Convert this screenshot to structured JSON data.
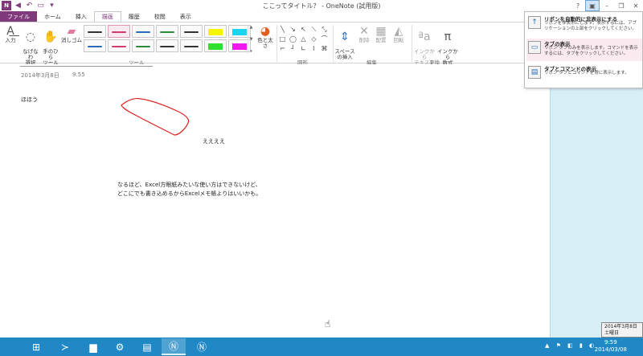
{
  "window": {
    "title": "ここってタイトル？ - OneNote (試用版)",
    "app_icon": "N",
    "min": "–",
    "restore": "❐",
    "close": "✕",
    "help": "?",
    "ribbon_display": "▣"
  },
  "tabs": [
    {
      "label": "ファイル",
      "file": true
    },
    {
      "label": "ホーム"
    },
    {
      "label": "挿入"
    },
    {
      "label": "描画",
      "selected": true
    },
    {
      "label": "履歴"
    },
    {
      "label": "校閲"
    },
    {
      "label": "表示"
    }
  ],
  "ribbon": {
    "type_text": "入力",
    "lasso": "なげなわ\n選択",
    "panning": "手のひら\nツール",
    "eraser": "消しゴム",
    "tools_label": "ツール",
    "color_thickness": "色と太さ",
    "shapes_label": "図形",
    "insert_space": "スペース\nの挿入",
    "delete": "削除",
    "arrange": "配置",
    "rotate": "回転",
    "edit_label": "編集",
    "ink_to_text": "インクから\nテキスト",
    "ink_to_math": "インクから\n数式",
    "convert_label": "変換"
  },
  "pens": [
    {
      "color": "#333333",
      "hl": false
    },
    {
      "color": "#d13c73",
      "hl": false,
      "selected": true
    },
    {
      "color": "#2b6cb8",
      "hl": false
    },
    {
      "color": "#2b8a3e",
      "hl": false
    },
    {
      "color": "#333333",
      "hl": false
    },
    {
      "color": "#f5f500",
      "hl": true
    },
    {
      "color": "#18d6f0",
      "hl": true
    },
    {
      "color": "#2b6cb8",
      "hl": false
    },
    {
      "color": "#d13c73",
      "hl": false
    },
    {
      "color": "#2b8a3e",
      "hl": false
    },
    {
      "color": "#333333",
      "hl": false
    },
    {
      "color": "#333333",
      "hl": false
    },
    {
      "color": "#2fe02f",
      "hl": true
    },
    {
      "color": "#f018f0",
      "hl": true
    }
  ],
  "shapes": [
    "╲",
    "↘",
    "↖",
    "⟍",
    "⤡",
    "□",
    "◯",
    "△",
    "◇",
    "⌒",
    "⌐",
    "┘",
    "∟",
    "⌇",
    "⌘"
  ],
  "page": {
    "date": "2014年3月8日",
    "time": "9:55",
    "text1": "ほほう",
    "text2": "ええええ",
    "text3_line1": "なるほど、Excel方眼紙みたいな使い方はできないけど、",
    "text3_line2": "どこにでも書き込めるからExcelメモ帳よりはいいかも。",
    "ink_color": "#e02020"
  },
  "ribbon_menu": [
    {
      "title": "リボンを自動的に非表示にする",
      "desc": "リボンを非表示にします。表示するには、アプリケーションの上部をクリックしてください。",
      "icon": "↑"
    },
    {
      "title": "タブの表示",
      "desc": "リボン タブのみを表示します。コマンドを表示するには、タブをクリックしてください。",
      "icon": "▭",
      "hover": true
    },
    {
      "title": "タブとコマンドの表示",
      "desc": "リボン タブとコマンドを常に表示します。",
      "icon": "▤"
    }
  ],
  "datetip": {
    "line1": "2014年3月8日",
    "line2": "土曜日"
  },
  "clock": {
    "time": "9:59",
    "date": "2014/03/08"
  },
  "tray_icons": "▲ ⚑ ◧ ▮ ◐"
}
